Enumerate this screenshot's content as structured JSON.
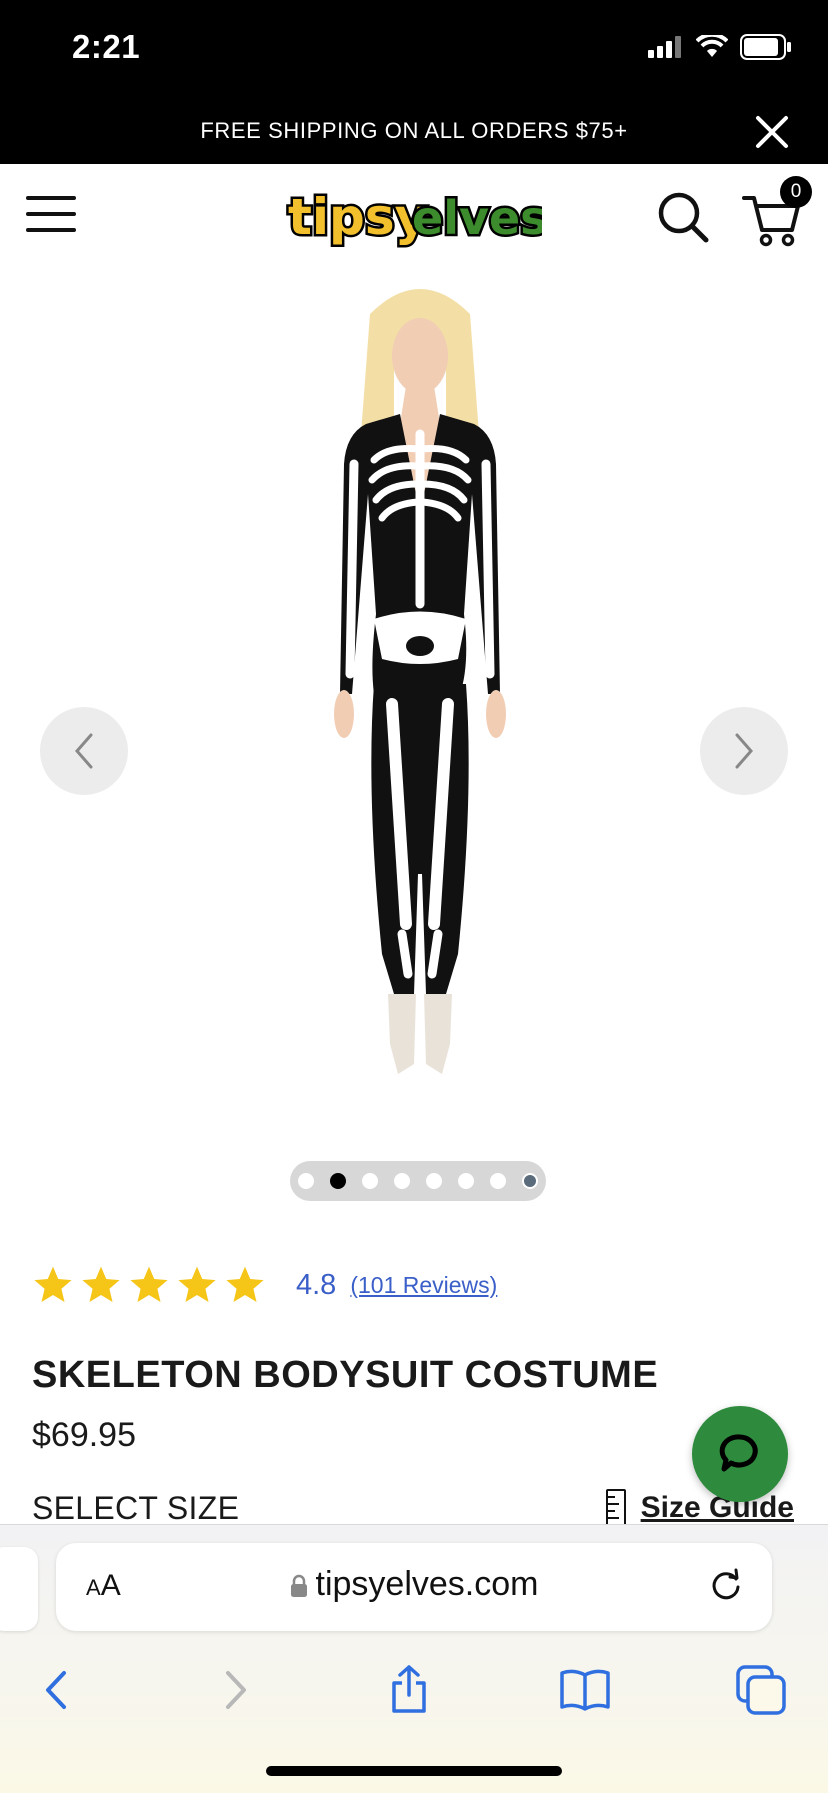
{
  "status_bar": {
    "time": "2:21",
    "icons": [
      "signal-icon",
      "wifi-icon",
      "battery-icon"
    ]
  },
  "promo": {
    "text": "FREE SHIPPING ON ALL ORDERS $75+",
    "close_icon": "close-icon"
  },
  "header": {
    "menu_icon": "hamburger-menu-icon",
    "logo_text": "tipsyelves",
    "search_icon": "search-icon",
    "cart_icon": "cart-icon",
    "cart_count": "0"
  },
  "gallery": {
    "prev_icon": "chevron-left-icon",
    "next_icon": "chevron-right-icon",
    "dot_count": 8,
    "active_dot": 2
  },
  "product": {
    "rating_value": "4.8",
    "reviews_label": "(101 Reviews)",
    "stars": 5,
    "title": "SKELETON BODYSUIT COSTUME",
    "price": "$69.95",
    "select_size_label": "SELECT SIZE",
    "size_guide_label": "Size Guide"
  },
  "chat": {
    "icon": "chat-bubble-icon"
  },
  "browser": {
    "text_size_label": "AA",
    "url": "tipsyelves.com",
    "toolbar": [
      "back-icon",
      "forward-icon",
      "share-icon",
      "bookmarks-icon",
      "tabs-icon"
    ]
  },
  "colors": {
    "link": "#3b5fc8",
    "star": "#f5c518",
    "chat": "#2e8b3d",
    "logo_yellow": "#f2c02c",
    "logo_green": "#3c8b2c"
  }
}
